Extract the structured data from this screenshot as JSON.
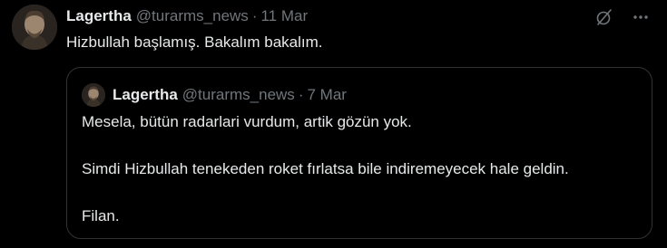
{
  "tweet": {
    "display_name": "Lagertha",
    "handle": "@turarms_news",
    "separator": "·",
    "date": "11 Mar",
    "text": "Hizbullah başlamış. Bakalım bakalım.",
    "actions": [
      {
        "icon": "grok-icon"
      },
      {
        "icon": "more-icon"
      }
    ]
  },
  "quote": {
    "display_name": "Lagertha",
    "handle": "@turarms_news",
    "separator": "·",
    "date": "7 Mar",
    "paragraphs": [
      "Mesela, bütün radarlari vurdum, artik gözün yok.",
      "Simdi Hizbullah tenekeden roket fırlatsa bile indiremeyecek hale geldin.",
      "Filan."
    ]
  },
  "colors": {
    "background": "#000000",
    "text_primary": "#e7e9ea",
    "text_secondary": "#71767b",
    "border": "#2f3336"
  }
}
